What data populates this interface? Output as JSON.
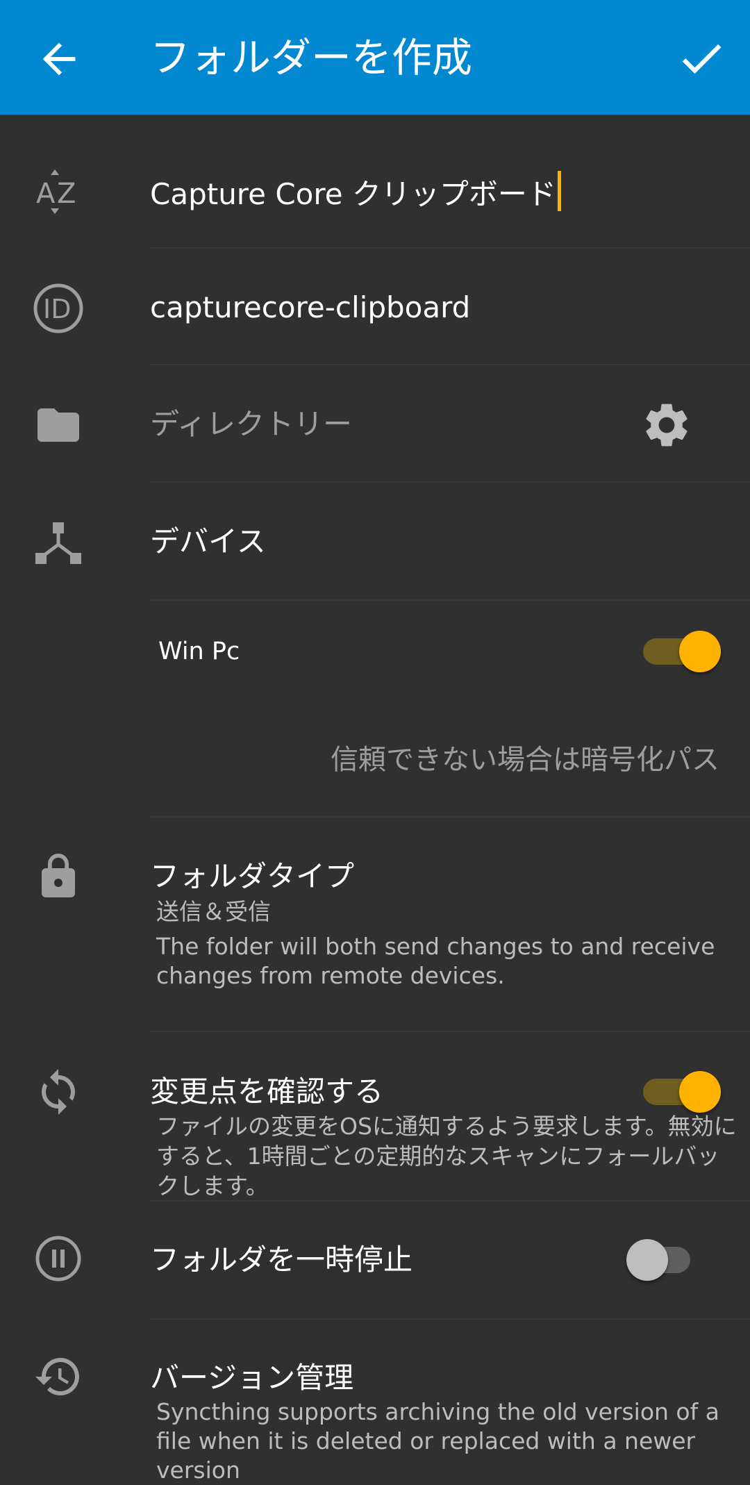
{
  "app_bar": {
    "title": "フォルダーを作成",
    "colors": {
      "background": "#0288d1",
      "text": "#ffffff"
    }
  },
  "fields": {
    "label": {
      "value": "Capture Core クリップボード",
      "icon": "sort-az-icon"
    },
    "folder_id": {
      "value": "capturecore-clipboard",
      "icon": "id-icon"
    },
    "directory": {
      "placeholder": "ディレクトリー",
      "icon": "folder-icon",
      "settings_icon": "gear-icon"
    }
  },
  "devices": {
    "header": "デバイス",
    "icon": "share-network-icon",
    "items": [
      {
        "name": "Win Pc",
        "enabled": true,
        "untrusted_password_hint": "信頼できない場合は暗号化パス"
      }
    ]
  },
  "folder_type": {
    "title": "フォルダタイプ",
    "value": "送信＆受信",
    "description": "The folder will both send changes to and receive changes from remote devices.",
    "icon": "lock-icon"
  },
  "watch_changes": {
    "title": "変更点を確認する",
    "description": "ファイルの変更をOSに通知するよう要求します。無効にすると、1時間ごとの定期的なスキャンにフォールバックします。",
    "enabled": true,
    "icon": "sync-icon"
  },
  "pause_folder": {
    "title": "フォルダを一時停止",
    "enabled": false,
    "icon": "pause-circle-icon"
  },
  "versioning": {
    "title": "バージョン管理",
    "description": "Syncthing supports archiving the old version of a file when it is deleted or replaced with a newer version",
    "icon": "history-icon"
  },
  "colors": {
    "background": "#303030",
    "accent": "#ffb300",
    "divider": "#383838"
  }
}
